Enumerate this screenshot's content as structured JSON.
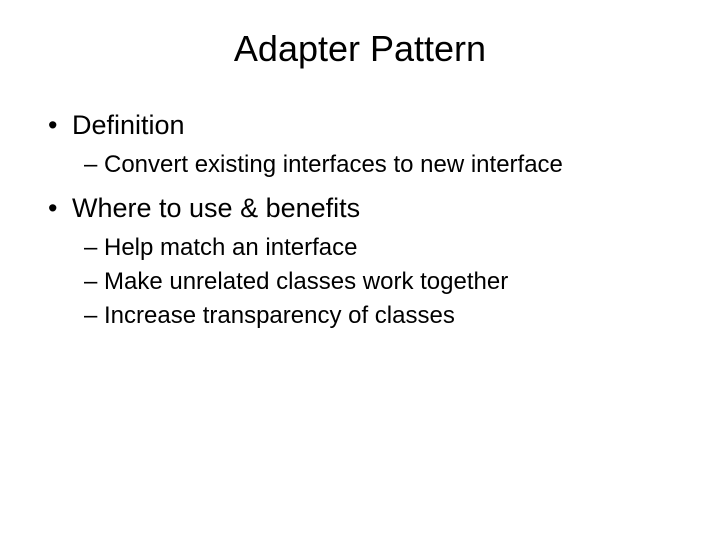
{
  "title": "Adapter Pattern",
  "sections": [
    {
      "heading": "Definition",
      "items": [
        "Convert existing interfaces to new interface"
      ]
    },
    {
      "heading": "Where to use & benefits",
      "items": [
        "Help match an interface",
        "Make unrelated classes work together",
        "Increase transparency of classes"
      ]
    }
  ]
}
